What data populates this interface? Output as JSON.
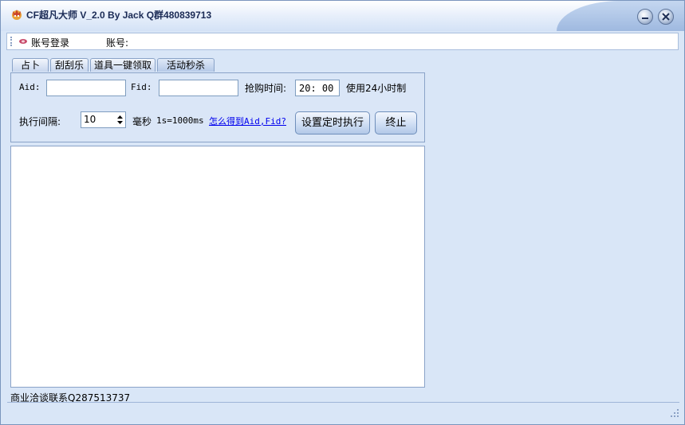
{
  "window": {
    "title": "CF超凡大师 V_2.0 By Jack Q群480839713",
    "minimize_icon": "minimize-icon",
    "close_icon": "close-icon"
  },
  "menubar": {
    "login_label": "账号登录",
    "account_label": "账号:"
  },
  "tabs": [
    {
      "label": "占卜"
    },
    {
      "label": "刮刮乐"
    },
    {
      "label": "道具一键领取"
    },
    {
      "label": "活动秒杀",
      "active": true
    }
  ],
  "form": {
    "aid_label": "Aid:",
    "aid_value": "",
    "fid_label": "Fid:",
    "fid_value": "",
    "buy_time_label": "抢购时间:",
    "buy_time_value": "20: 00",
    "hint_24h": "使用24小时制",
    "interval_label": "执行间隔:",
    "interval_value": "10",
    "ms_label": "毫秒",
    "ms_hint": "1s=1000ms",
    "help_link": "怎么得到Aid,Fid?",
    "schedule_button": "设置定时执行",
    "stop_button": "终止"
  },
  "log": {
    "content": ""
  },
  "status": {
    "text": "商业洽谈联系Q287513737"
  }
}
